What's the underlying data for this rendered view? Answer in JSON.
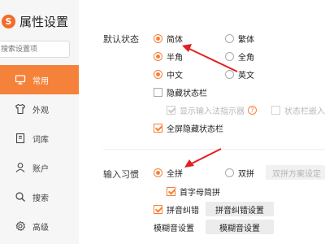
{
  "app": {
    "title": "属性设置",
    "logo_glyph": "S",
    "accent_color": "#f5823a"
  },
  "sidebar": {
    "search_placeholder": "搜索设置项",
    "items": [
      {
        "label": "常用",
        "icon": "monitor-icon",
        "active": true
      },
      {
        "label": "外观",
        "icon": "shirt-icon",
        "active": false
      },
      {
        "label": "词库",
        "icon": "book-icon",
        "active": false
      },
      {
        "label": "账户",
        "icon": "user-icon",
        "active": false
      },
      {
        "label": "搜索",
        "icon": "search-icon",
        "active": false
      },
      {
        "label": "高级",
        "icon": "gear-icon",
        "active": false
      }
    ]
  },
  "main": {
    "default_state": {
      "label": "默认状态",
      "simplified": "简体",
      "traditional": "繁体",
      "half_width": "半角",
      "full_width": "全角",
      "chinese": "中文",
      "english": "英文",
      "hide_status_bar": "隐藏状态栏",
      "show_indicator": "显示输入法指示器",
      "status_bar_embed": "状态栏嵌入",
      "fullscreen_hide": "全屏隐藏状态栏"
    },
    "input_habit": {
      "label": "输入习惯",
      "full_pinyin": "全拼",
      "double_pinyin": "双拼",
      "double_scheme_btn": "双拼方案设定",
      "initial_abbrev": "首字母简拼",
      "pinyin_correction": "拼音纠错",
      "pinyin_correction_btn": "拼音纠错设置",
      "fuzzy_label": "模糊音设置",
      "fuzzy_btn": "模糊音设置"
    }
  }
}
